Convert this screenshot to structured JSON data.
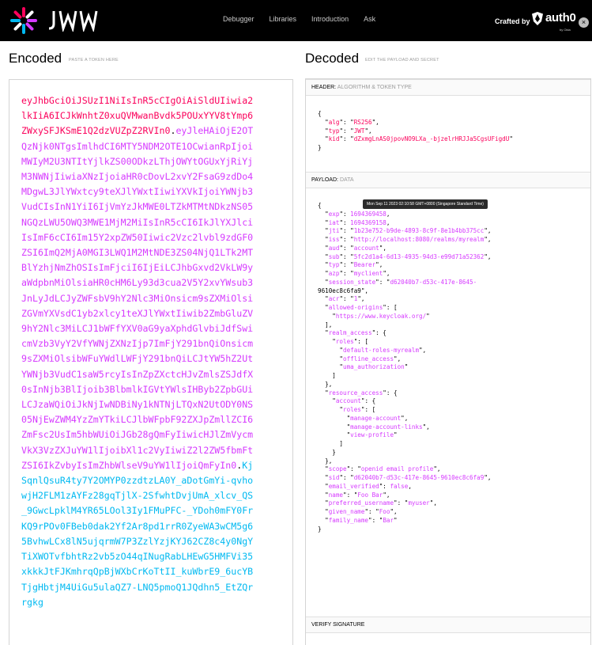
{
  "nav": {
    "brand": "JWT",
    "links": [
      "Debugger",
      "Libraries",
      "Introduction",
      "Ask"
    ],
    "crafted_by": "Crafted by",
    "auth0": "auth0",
    "auth0_by": "by Okta",
    "close": "×"
  },
  "encoded": {
    "title": "Encoded",
    "subtitle": "PASTE A TOKEN HERE",
    "token_header": "eyJhbGciOiJSUzI1NiIsInR5cCIgOiAiSldUIiwia2lkIiA6ICJkWnhtZ0xuQVMwanBvdk5POUxYYV8tYmp6ZWxySFJKSmE1Q2dzVUZpZ2RVIn0",
    "token_payload": "eyJleHAiOjE2OTQzNjk0NTgsImlhdCI6MTY5NDM2OTE1OCwianRpIjoiMWIyM2U3NTItYjlkZS00ODkzLThjOWYtOGUxYjRiYjM3NWNjIiwiaXNzIjoiaHR0cDovL2xvY2FsaG9zdDo4MDgwL3JlYWxtcy9teXJlYWxtIiwiYXVkIjoiYWNjb3VudCIsInN1YiI6IjVmYzJkMWE0LTZkMTMtNDkzNS05NGQzLWU5OWQ3MWE1MjM2MiIsInR5cCI6IkJlYXJlciIsImF6cCI6Im15Y2xpZW50Iiwic2Vzc2lvbl9zdGF0ZSI6ImQ2MjA0MGI3LWQ1M2MtNDE3ZS04NjQ1LTk2MTBlYzhjNmZhOSIsImFjciI6IjEiLCJhbGxvd2VkLW9yaWdpbnMiOlsiaHR0cHM6Ly93d3cua2V5Y2xvYWsub3JnLyJdLCJyZWFsbV9hY2Nlc3MiOnsicm9sZXMiOlsiZGVmYXVsdC1yb2xlcy1teXJlYWxtIiwib2ZmbGluZV9hY2Nlc3MiLCJ1bWFfYXV0aG9yaXphdGlvbiJdfSwicmVzb3VyY2VfYWNjZXNzIjp7ImFjY291bnQiOnsicm9sZXMiOlsibWFuYWdlLWFjY291bnQiLCJtYW5hZ2UtYWNjb3VudC1saW5rcyIsInZpZXctcHJvZmlsZSJdfX0sInNjb3BlIjoib3BlbmlkIGVtYWlsIHByb2ZpbGUiLCJzaWQiOiJkNjIwNDBiNy1kNTNjLTQxN2UtODY0NS05NjEwZWM4YzZmYTkiLCJlbWFpbF92ZXJpZmllZCI6ZmFsc2UsIm5hbWUiOiJGb28gQmFyIiwicHJlZmVycmVkX3VzZXJuYW1lIjoibXl1c2VyIiwiZ2l2ZW5fbmFtZSI6IkZvbyIsImZhbWlseV9uYW1lIjoiQmFyIn0",
    "token_signature": "KjSqnlQsuR4ty7Y2OMYP0zzdtzLA0Y_aDotGmYi-qvhowjH2FLM1zAYFz28gqTjlX-2SfwhtDvjUmA_xlcv_QS_9GwcLpklM4YR65LOol3Iy1FMuPFC-_YDoh0mFY0FrKQ9rPOv0FBeb0dak2Yf2Ar8pd1rrR0ZyeWA3wCM5g65BvhwLCx8lN5ujqrmW7P3ZzlYzjKYJ62CZ8c4y0NgYTiXWOTvfbhtRz2vb5zO44qINugRabLHEwG5HMFVi35xkkkJtFJKmhrqQpBjWXbCrKoTtII_kuWbrE9_6ucYBTjgHbtjM4UiGu5ulaQZ7-LNQ5pmoQ1JQdhn5_EtZQrrgkg"
  },
  "decoded": {
    "title": "Decoded",
    "subtitle": "EDIT THE PAYLOAD AND SECRET",
    "header_label": "HEADER:",
    "header_desc": "ALGORITHM & TOKEN TYPE",
    "payload_label": "PAYLOAD:",
    "payload_desc": "DATA",
    "verify_label": "VERIFY SIGNATURE",
    "tooltip": "Mon Sep 11 2023 02:10:58 GMT+0800 (Singapore Standard Time)",
    "header_json": {
      "alg": "RS256",
      "typ": "JWT",
      "kid": "dZxmgLnAS0jpovNO9LXa_-bjzelrHRJJa5CgsUFigdU"
    },
    "payload_json": {
      "exp": "1694369458",
      "iat": "1694369158",
      "jti": "1b23e752-b9de-4893-8c9f-8e1b4bb375cc",
      "iss": "http://localhost:8080/realms/myrealm",
      "aud": "account",
      "sub": "5fc2d1a4-6d13-4935-94d3-e99d71a52362",
      "typ": "Bearer",
      "azp": "myclient",
      "session_state": "d62040b7-d53c-417e-8645-9610ec8c6fa9",
      "acr": "1",
      "allowed_origins_0": "https://www.keycloak.org/",
      "realm_roles_0": "default-roles-myrealm",
      "realm_roles_1": "offline_access",
      "realm_roles_2": "uma_authorization",
      "account_roles_0": "manage-account",
      "account_roles_1": "manage-account-links",
      "account_roles_2": "view-profile",
      "scope": "openid email profile",
      "sid": "d62040b7-d53c-417e-8645-9610ec8c6fa9",
      "email_verified": "false",
      "name": "Foo Bar",
      "preferred_username": "myuser",
      "given_name": "Foo",
      "family_name": "Bar"
    }
  }
}
